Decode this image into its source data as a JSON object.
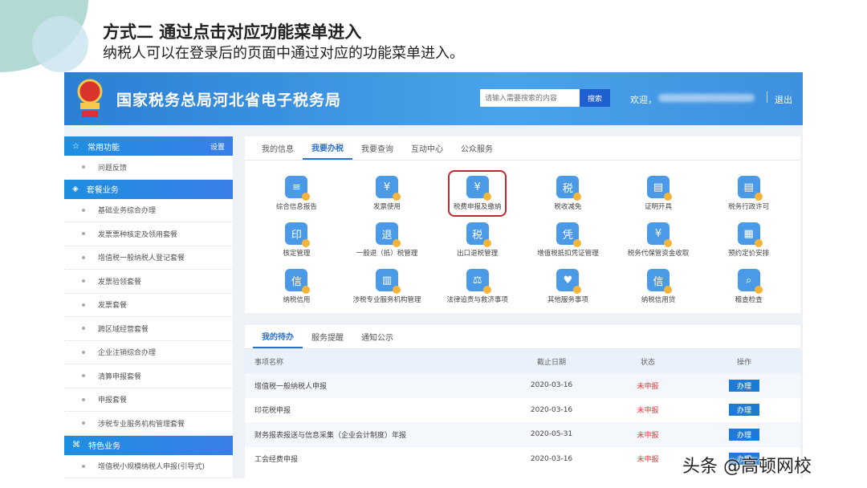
{
  "slide": {
    "title": "方式二 通过点击对应功能菜单进入",
    "subtitle": "纳税人可以在登录后的页面中通过对应的功能菜单进入。"
  },
  "header": {
    "site_name": "国家税务总局河北省电子税务局",
    "search_placeholder": "请输入需要搜索的内容",
    "search_button": "搜索",
    "welcome": "欢迎，",
    "logout": "退出"
  },
  "sidebar": {
    "sections": [
      {
        "title": "常用功能",
        "action": "设置",
        "items": [
          "问题反馈"
        ]
      },
      {
        "title": "套餐业务",
        "items": [
          "基础业务综合办理",
          "发票票种核定及领用套餐",
          "增值税一般纳税人登记套餐",
          "发票验领套餐",
          "发票套餐",
          "跨区域经营套餐",
          "企业注销综合办理",
          "清算申报套餐",
          "申报套餐",
          "涉税专业服务机构管理套餐"
        ]
      },
      {
        "title": "特色业务",
        "items": [
          "增值税小规模纳税人申报(引导式)"
        ]
      }
    ]
  },
  "main": {
    "tabs": [
      "我的信息",
      "我要办税",
      "我要查询",
      "互动中心",
      "公众服务"
    ],
    "functions": [
      {
        "label": "综合信息报告",
        "icon": "≡"
      },
      {
        "label": "发票使用",
        "icon": "¥"
      },
      {
        "label": "税费申报及缴纳",
        "icon": "¥"
      },
      {
        "label": "税收减免",
        "icon": "税"
      },
      {
        "label": "证明开具",
        "icon": "▤"
      },
      {
        "label": "税务行政许可",
        "icon": "▤"
      },
      {
        "label": "核定管理",
        "icon": "印"
      },
      {
        "label": "一般退（抵）税管理",
        "icon": "退"
      },
      {
        "label": "出口退税管理",
        "icon": "税"
      },
      {
        "label": "增值税抵扣凭证管理",
        "icon": "凭"
      },
      {
        "label": "税务代保管资金收取",
        "icon": "¥"
      },
      {
        "label": "预约定价安排",
        "icon": "▦"
      },
      {
        "label": "纳税信用",
        "icon": "信"
      },
      {
        "label": "涉税专业服务机构管理",
        "icon": "▥"
      },
      {
        "label": "法律追责与救济事项",
        "icon": "⚖"
      },
      {
        "label": "其他服务事项",
        "icon": "♥"
      },
      {
        "label": "纳税信用贷",
        "icon": "信"
      },
      {
        "label": "稽查检查",
        "icon": "⌕"
      }
    ]
  },
  "todo": {
    "tabs": [
      "我的待办",
      "服务提醒",
      "通知公示"
    ],
    "columns": [
      "事项名称",
      "截止日期",
      "状态",
      "操作"
    ],
    "rows": [
      {
        "name": "增值税一般纳税人申报",
        "date": "2020-03-16",
        "status": "未申报",
        "action": "办理"
      },
      {
        "name": "印花税申报",
        "date": "2020-03-16",
        "status": "未申报",
        "action": "办理"
      },
      {
        "name": "财务报表报送与信息采集（企业会计制度）年报",
        "date": "2020-05-31",
        "status": "未申报",
        "action": "办理"
      },
      {
        "name": "工会经费申报",
        "date": "2020-03-16",
        "status": "未申报",
        "action": "办理"
      }
    ]
  },
  "watermark": "头条 @高顿网校"
}
